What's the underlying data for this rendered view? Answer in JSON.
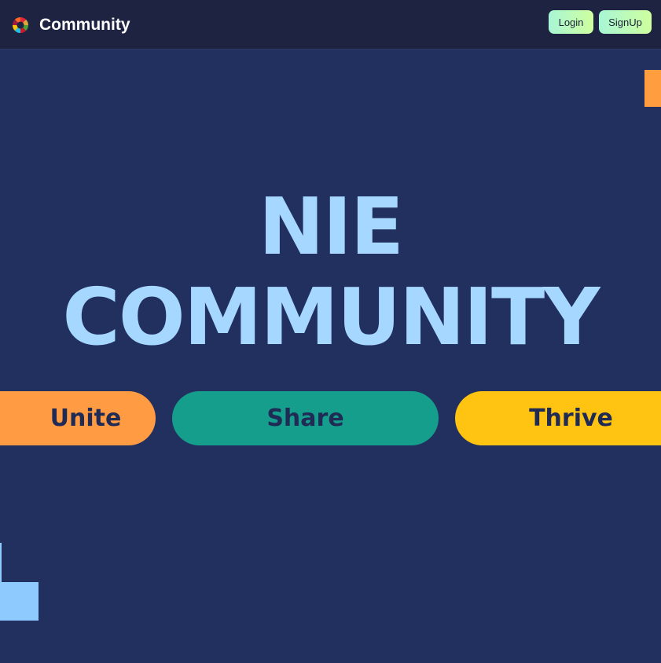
{
  "navbar": {
    "logo_icon": "colorful-wheel-icon",
    "brand": "Community",
    "login_label": "Login",
    "signup_label": "SignUp"
  },
  "hero": {
    "title_line1": "NIE",
    "title_line2": "COMMUNITY",
    "pills": [
      {
        "label": "Unite",
        "color": "#ff9b42"
      },
      {
        "label": "Share",
        "color": "#169e8c"
      },
      {
        "label": "Thrive",
        "color": "#ffc411"
      }
    ]
  },
  "colors": {
    "page_background": "#22305f",
    "navbar_background": "#1d2340",
    "title": "#a6d7ff",
    "button_gradient_start": "#a8f6d6",
    "button_gradient_end": "#cfff9e",
    "accent_orange": "#ff9d3f",
    "accent_blue": "#8fcaff"
  }
}
